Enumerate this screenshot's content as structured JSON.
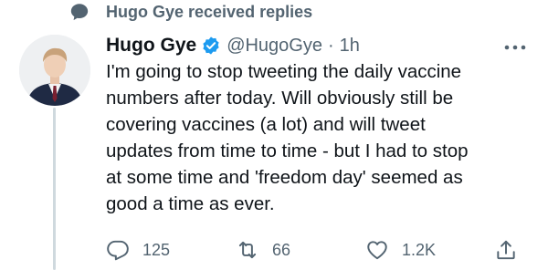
{
  "context": {
    "icon": "chat-bubble-icon",
    "text": "Hugo Gye received replies"
  },
  "tweet": {
    "author_name": "Hugo Gye",
    "verified_icon": "verified-badge-icon",
    "handle": "@HugoGye",
    "separator": "·",
    "time": "1h",
    "more_icon": "more-options-icon",
    "text": "I'm going to stop tweeting the daily vaccine\nnumbers after today. Will obviously still be\ncovering vaccines (a lot) and will tweet\nupdates from time to time - but I had to stop\nat some time and 'freedom day' seemed as\ngood a time as ever."
  },
  "actions": {
    "reply": {
      "icon": "reply-icon",
      "count": "125"
    },
    "retweet": {
      "icon": "retweet-icon",
      "count": "66"
    },
    "like": {
      "icon": "heart-icon",
      "count": "1.2K"
    },
    "share": {
      "icon": "share-icon"
    }
  },
  "colors": {
    "primary_text": "#0f1419",
    "secondary_text": "#536471",
    "verified_blue": "#1d9bf0",
    "thread_line": "#cfd9de"
  }
}
